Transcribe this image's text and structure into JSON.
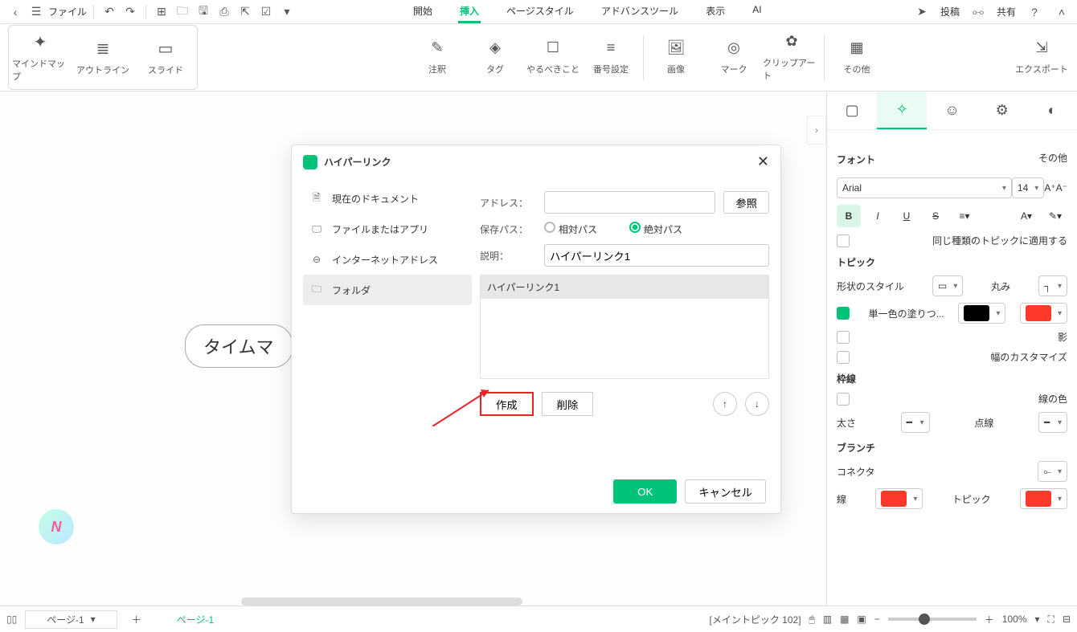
{
  "topbar": {
    "file_label": "ファイル",
    "tabs": {
      "start": "開始",
      "insert": "挿入",
      "pagestyle": "ページスタイル",
      "advanced": "アドバンスツール",
      "view": "表示",
      "ai": "AI"
    },
    "post": "投稿",
    "share": "共有"
  },
  "ribbon": {
    "views": {
      "mindmap": "マインドマップ",
      "outline": "アウトライン",
      "slide": "スライド"
    },
    "items": {
      "annotate": "注釈",
      "tag": "タグ",
      "todo": "やるべきこと",
      "numbering": "番号設定",
      "image": "画像",
      "mark": "マーク",
      "clipart": "クリップアート",
      "other": "その他"
    },
    "export": "エクスポート"
  },
  "canvas": {
    "topic": "タイムマ"
  },
  "modal": {
    "title": "ハイパーリンク",
    "nav": {
      "current": "現在のドキュメント",
      "fileapp": "ファイルまたはアプリ",
      "url": "インターネットアドレス",
      "folder": "フォルダ"
    },
    "address_label": "アドレス：",
    "browse": "参照",
    "savepath_label": "保存パス：",
    "relative": "相対パス",
    "absolute": "絶対パス",
    "desc_label": "説明：",
    "desc_value": "ハイパーリンク1",
    "link_row": "ハイパーリンク1",
    "create": "作成",
    "delete": "削除",
    "ok": "OK",
    "cancel": "キャンセル"
  },
  "side": {
    "font": "フォント",
    "other": "その他",
    "font_family": "Arial",
    "font_size": "14",
    "apply_same": "同じ種類のトピックに適用する",
    "topic": "トピック",
    "shape_style": "形状のスタイル",
    "round": "丸み",
    "solid_fill": "単一色の塗りつ...",
    "shadow": "影",
    "custom_width": "幅のカスタマイズ",
    "border": "枠線",
    "line_color": "線の色",
    "weight": "太さ",
    "dash": "点線",
    "branch": "ブランチ",
    "connector": "コネクタ",
    "line": "線",
    "btopic": "トピック"
  },
  "status": {
    "page_combo": "ページ-1",
    "page_tab": "ページ-1",
    "main_topic": "[メイントピック 102]",
    "zoom": "100%"
  }
}
